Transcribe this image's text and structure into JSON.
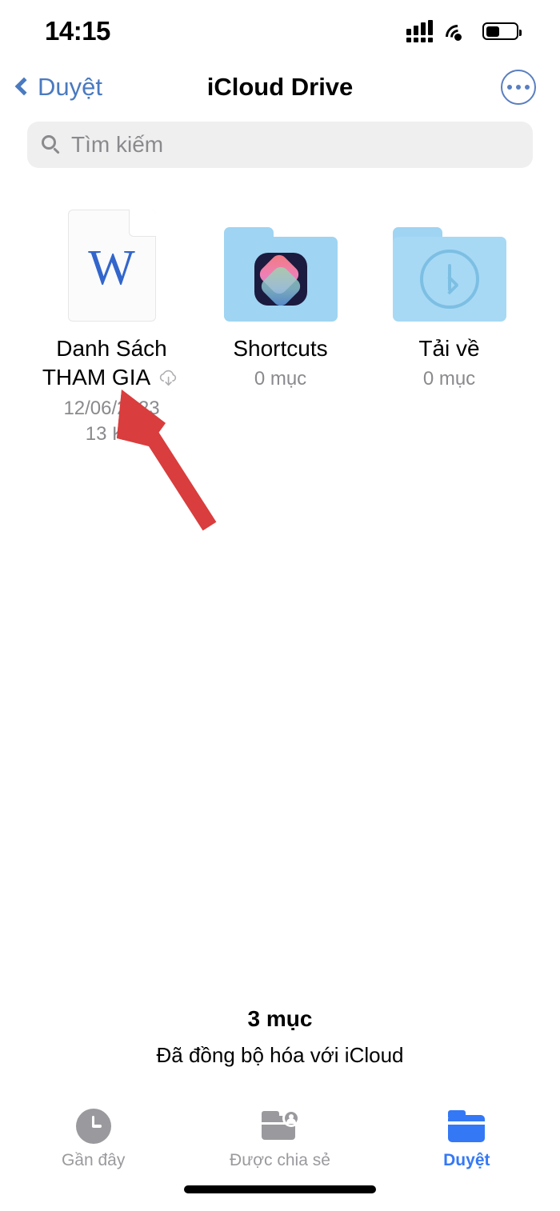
{
  "status_bar": {
    "time": "14:15",
    "signal_icon": "cellular-signal-icon",
    "wifi_icon": "wifi-icon",
    "battery_icon": "battery-icon",
    "battery_level_percent": 40
  },
  "nav": {
    "back_label": "Duyệt",
    "back_icon": "chevron-left-icon",
    "title": "iCloud Drive",
    "more_icon": "ellipsis-circle-icon"
  },
  "search": {
    "placeholder": "Tìm kiếm",
    "value": "",
    "icon": "search-icon"
  },
  "items": [
    {
      "icon": "word-document-icon",
      "glyph": "W",
      "name_line1": "Danh Sách",
      "name_line2": "THAM GIA",
      "badge_icon": "icloud-download-icon",
      "meta_line1": "12/06/2023",
      "meta_line2": "13 KB"
    },
    {
      "icon": "folder-shortcuts-icon",
      "name_line1": "Shortcuts",
      "name_line2": "",
      "meta_line1": "0 mục",
      "meta_line2": ""
    },
    {
      "icon": "folder-downloads-icon",
      "name_line1": "Tải về",
      "name_line2": "",
      "meta_line1": "0 mục",
      "meta_line2": ""
    }
  ],
  "footer": {
    "count": "3 mục",
    "sync_status": "Đã đồng bộ hóa với iCloud"
  },
  "tabbar": {
    "tabs": [
      {
        "label": "Gần đây",
        "icon": "clock-icon",
        "active": false
      },
      {
        "label": "Được chia sẻ",
        "icon": "shared-folder-icon",
        "active": false
      },
      {
        "label": "Duyệt",
        "icon": "folder-icon",
        "active": true
      }
    ]
  },
  "annotation": {
    "arrow_color": "#d93d3d",
    "arrow_icon": "pointer-arrow-annotation"
  },
  "colors": {
    "accent_blue": "#3478f6",
    "nav_blue": "#4a7ac0",
    "folder_blue": "#9fd4f2",
    "muted_gray": "#8a8a8e",
    "search_bg": "#efeff0"
  }
}
